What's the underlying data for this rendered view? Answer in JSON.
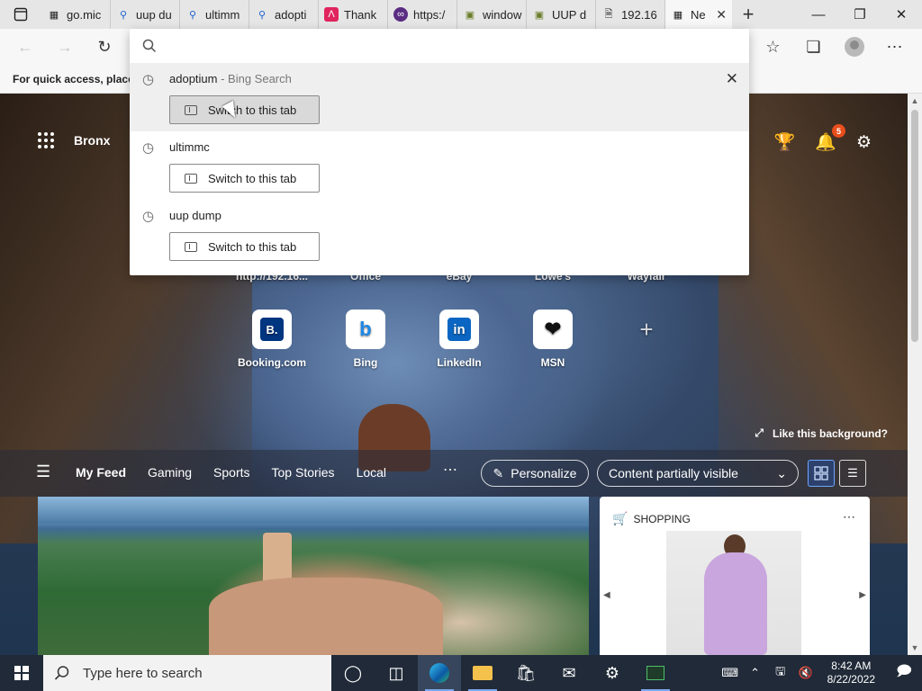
{
  "browser": {
    "tabs": [
      {
        "title": "go.mic",
        "icon": "file-icon"
      },
      {
        "title": "uup du",
        "icon": "search-icon"
      },
      {
        "title": "ultimm",
        "icon": "search-icon"
      },
      {
        "title": "adopti",
        "icon": "search-icon"
      },
      {
        "title": "Thank",
        "icon": "app-icon"
      },
      {
        "title": "https:/",
        "icon": "link-icon"
      },
      {
        "title": "window",
        "icon": "archive-icon"
      },
      {
        "title": "UUP d",
        "icon": "archive-icon"
      },
      {
        "title": "192.16",
        "icon": "page-icon"
      }
    ],
    "active_tab": {
      "title": "Ne",
      "icon": "newtab-icon"
    },
    "favorites_bar_text": "For quick access, place y"
  },
  "omnibox": {
    "query": "",
    "suggestions": [
      {
        "text": "adoptium",
        "sub": " - Bing Search",
        "button": "Switch to this tab",
        "hovered": true
      },
      {
        "text": "ultimmc",
        "sub": "",
        "button": "Switch to this tab",
        "hovered": false
      },
      {
        "text": "uup dump",
        "sub": "",
        "button": "Switch to this tab",
        "hovered": false
      }
    ]
  },
  "newtab": {
    "location": "Bronx",
    "notifications_count": "5",
    "quicklinks_row1": [
      {
        "label": "http://192.16...",
        "icon": "page-icon",
        "color": "#7f3fb8"
      },
      {
        "label": "Office",
        "icon": "office-icon",
        "color": "#d83b01"
      },
      {
        "label": "eBay",
        "icon": "ebay-icon",
        "color": "#e53238"
      },
      {
        "label": "Lowe's",
        "icon": "lowes-icon",
        "color": "#004990"
      },
      {
        "label": "Wayfair",
        "icon": "wayfair-icon",
        "color": "#7b189f"
      }
    ],
    "quicklinks_row2": [
      {
        "label": "Booking.com",
        "glyph": "B.",
        "color": "#003580"
      },
      {
        "label": "Bing",
        "glyph": "b",
        "color": "#1e88e5"
      },
      {
        "label": "LinkedIn",
        "glyph": "in",
        "color": "#0a66c2"
      },
      {
        "label": "MSN",
        "glyph": "❤",
        "color": "#111111"
      }
    ],
    "like_background": "Like this background?",
    "feed": {
      "tabs": [
        "My Feed",
        "Gaming",
        "Sports",
        "Top Stories",
        "Local"
      ],
      "personalize": "Personalize",
      "content_visibility": "Content partially visible",
      "shopping_label": "SHOPPING"
    }
  },
  "taskbar": {
    "search_placeholder": "Type here to search",
    "time": "8:42 AM",
    "date": "8/22/2022"
  }
}
